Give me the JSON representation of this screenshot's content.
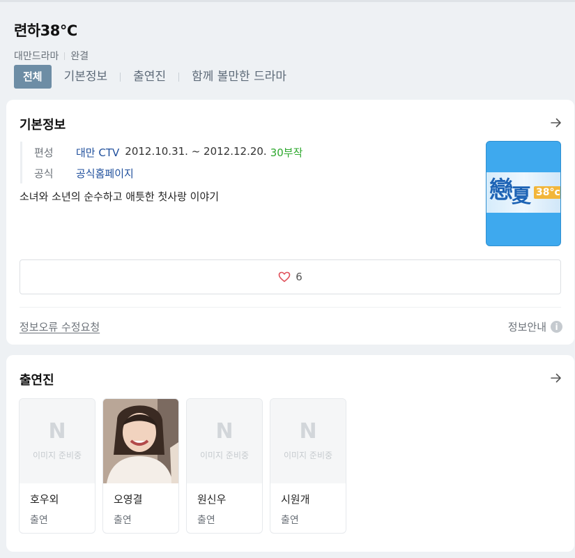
{
  "header": {
    "title": "련하38℃",
    "genre": "대만드라마",
    "status": "완결"
  },
  "tabs": [
    {
      "label": "전체",
      "active": true
    },
    {
      "label": "기본정보",
      "active": false
    },
    {
      "label": "출연진",
      "active": false
    },
    {
      "label": "함께 볼만한 드라마",
      "active": false
    }
  ],
  "basic_info": {
    "section_title": "기본정보",
    "broadcast_label": "편성",
    "broadcast_channel": "대만 CTV",
    "broadcast_period": "2012.10.31. ~ 2012.12.20.",
    "episodes": "30부작",
    "official_label": "공식",
    "official_link": "공식홈페이지",
    "description": "소녀와 소년의 순수하고 애틋한 첫사랑 이야기",
    "poster_chars": "戀夏",
    "poster_badge": "38°c",
    "like_count": "6",
    "report_link": "정보오류 수정요청",
    "info_guide": "정보안내"
  },
  "cast_section": {
    "section_title": "출연진",
    "placeholder_text": "이미지 준비중",
    "members": [
      {
        "name": "호우외",
        "role": "출연",
        "has_photo": false
      },
      {
        "name": "오영결",
        "role": "출연",
        "has_photo": true
      },
      {
        "name": "원신우",
        "role": "출연",
        "has_photo": false
      },
      {
        "name": "시원개",
        "role": "출연",
        "has_photo": false
      }
    ]
  },
  "colors": {
    "active_tab": "#6d8da5",
    "link_blue": "#1f4f9c",
    "episodes_green": "#2ea82e",
    "poster_blue": "#3ea9ee"
  }
}
